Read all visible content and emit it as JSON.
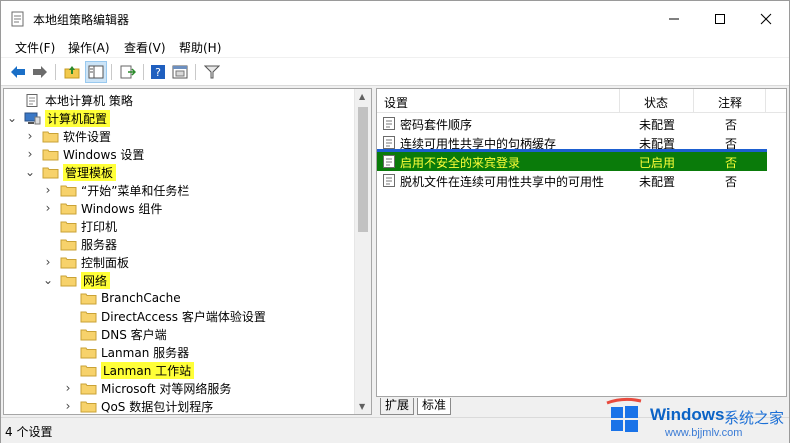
{
  "window": {
    "title": "本地组策略编辑器",
    "minimize_icon": "minimize-icon",
    "maximize_icon": "maximize-icon",
    "close_icon": "close-icon"
  },
  "menubar": {
    "items": [
      "文件(F)",
      "操作(A)",
      "查看(V)",
      "帮助(H)"
    ]
  },
  "toolbar": {
    "buttons": [
      "back-arrow-icon",
      "forward-arrow-icon",
      "up-folder-icon",
      "show-hide-tree-icon",
      "export-list-icon",
      "help-icon",
      "properties-icon",
      "filter-icon"
    ]
  },
  "tree": {
    "nodes": [
      {
        "label": "本地计算机 策略",
        "highlight": false,
        "expand": "none",
        "icon": "policy-doc-icon"
      },
      {
        "label": "计算机配置",
        "highlight": true,
        "expand": "open",
        "icon": "computer-icon"
      },
      {
        "label": "软件设置",
        "highlight": false,
        "expand": "closed",
        "icon": "folder-icon"
      },
      {
        "label": "Windows 设置",
        "highlight": false,
        "expand": "closed",
        "icon": "folder-icon"
      },
      {
        "label": "管理模板",
        "highlight": true,
        "expand": "open",
        "icon": "folder-icon"
      },
      {
        "label": "“开始”菜单和任务栏",
        "highlight": false,
        "expand": "closed",
        "icon": "folder-icon"
      },
      {
        "label": "Windows 组件",
        "highlight": false,
        "expand": "closed",
        "icon": "folder-icon"
      },
      {
        "label": "打印机",
        "highlight": false,
        "expand": "none",
        "icon": "folder-icon"
      },
      {
        "label": "服务器",
        "highlight": false,
        "expand": "none",
        "icon": "folder-icon"
      },
      {
        "label": "控制面板",
        "highlight": false,
        "expand": "closed",
        "icon": "folder-icon"
      },
      {
        "label": "网络",
        "highlight": true,
        "expand": "open",
        "icon": "folder-icon"
      },
      {
        "label": "BranchCache",
        "highlight": false,
        "expand": "none",
        "icon": "folder-icon"
      },
      {
        "label": "DirectAccess 客户端体验设置",
        "highlight": false,
        "expand": "none",
        "icon": "folder-icon"
      },
      {
        "label": "DNS 客户端",
        "highlight": false,
        "expand": "none",
        "icon": "folder-icon"
      },
      {
        "label": "Lanman 服务器",
        "highlight": false,
        "expand": "none",
        "icon": "folder-icon"
      },
      {
        "label": "Lanman 工作站",
        "highlight": true,
        "expand": "none",
        "icon": "folder-icon"
      },
      {
        "label": "Microsoft 对等网络服务",
        "highlight": false,
        "expand": "closed",
        "icon": "folder-icon"
      },
      {
        "label": "QoS 数据包计划程序",
        "highlight": false,
        "expand": "closed",
        "icon": "folder-icon"
      }
    ]
  },
  "list": {
    "headers": {
      "setting": "设置",
      "state": "状态",
      "comment": "注释"
    },
    "rows": [
      {
        "setting": "密码套件顺序",
        "state": "未配置",
        "comment": "否",
        "selected": false
      },
      {
        "setting": "连续可用性共享中的句柄缓存",
        "state": "未配置",
        "comment": "否",
        "selected": false
      },
      {
        "setting": "启用不安全的来宾登录",
        "state": "已启用",
        "comment": "否",
        "selected": true
      },
      {
        "setting": "脱机文件在连续可用性共享中的可用性",
        "state": "未配置",
        "comment": "否",
        "selected": false
      }
    ]
  },
  "tabs": [
    "扩展",
    "标准"
  ],
  "status": {
    "text": "4 个设置"
  },
  "watermark": {
    "title": "Windows",
    "cn": "系统之家",
    "url": "www.bjjmlv.com"
  },
  "colors": {
    "highlight": "#ffff38",
    "selected_row": "#0a7b0a",
    "selected_text": "#ffff38",
    "blue_band": "#1d5fd0"
  }
}
